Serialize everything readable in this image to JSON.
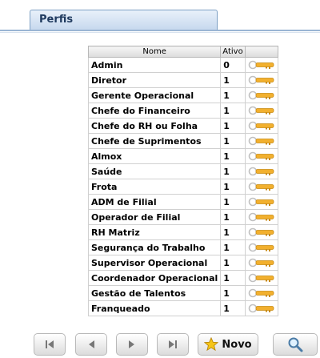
{
  "header": {
    "title": "Perfis"
  },
  "table": {
    "columns": [
      "Nome",
      "Ativo",
      ""
    ],
    "rows": [
      {
        "nome": "Admin",
        "ativo": "0"
      },
      {
        "nome": "Diretor",
        "ativo": "1"
      },
      {
        "nome": "Gerente Operacional",
        "ativo": "1"
      },
      {
        "nome": "Chefe do Financeiro",
        "ativo": "1"
      },
      {
        "nome": "Chefe do RH ou Folha",
        "ativo": "1"
      },
      {
        "nome": "Chefe de Suprimentos",
        "ativo": "1"
      },
      {
        "nome": "Almox",
        "ativo": "1"
      },
      {
        "nome": "Saúde",
        "ativo": "1"
      },
      {
        "nome": "Frota",
        "ativo": "1"
      },
      {
        "nome": "ADM de Filial",
        "ativo": "1"
      },
      {
        "nome": "Operador de Filial",
        "ativo": "1"
      },
      {
        "nome": "RH Matriz",
        "ativo": "1"
      },
      {
        "nome": "Segurança do Trabalho",
        "ativo": "1"
      },
      {
        "nome": "Supervisor Operacional",
        "ativo": "1"
      },
      {
        "nome": "Coordenador Operacional",
        "ativo": "1"
      },
      {
        "nome": "Gestão de Talentos",
        "ativo": "1"
      },
      {
        "nome": "Franqueado",
        "ativo": "1"
      }
    ],
    "row_icon": "key-icon"
  },
  "toolbar": {
    "first_icon": "first-page-icon",
    "prev_icon": "prev-page-icon",
    "next_icon": "next-page-icon",
    "last_icon": "last-page-icon",
    "novo_label": "Novo",
    "novo_icon": "star-icon",
    "search_icon": "search-icon"
  },
  "colors": {
    "tab_text": "#1f3a5f",
    "key": "#f2b02e",
    "star": "#f5c518"
  }
}
